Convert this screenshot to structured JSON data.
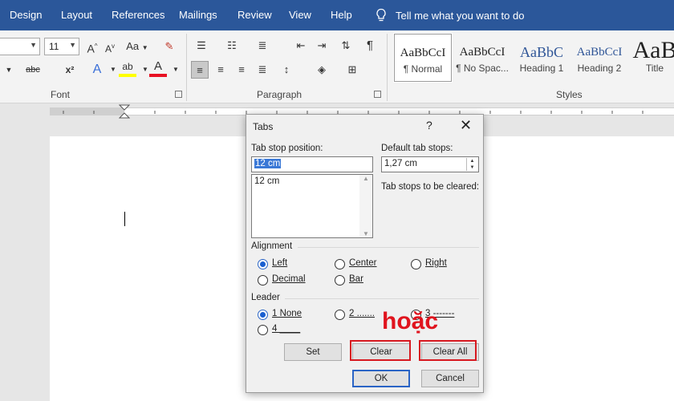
{
  "ribbon_tabs": [
    "Design",
    "Layout",
    "References",
    "Mailings",
    "Review",
    "View",
    "Help"
  ],
  "tell_me": "Tell me what you want to do",
  "font": {
    "size": "11",
    "group_label": "Font",
    "grow_label": "A",
    "shrink_label": "A",
    "case_label": "Aa",
    "strike_label": "abc",
    "superscript_label": "x²",
    "effects_label": "A",
    "highlight_label": "ab",
    "color_label": "A"
  },
  "paragraph": {
    "group_label": "Paragraph",
    "pilcrow": "¶"
  },
  "styles": {
    "group_label": "Styles",
    "items": [
      {
        "sample": "AaBbCcI",
        "name": "¶ Normal"
      },
      {
        "sample": "AaBbCcI",
        "name": "¶ No Spac..."
      },
      {
        "sample": "AaBbC",
        "name": "Heading 1"
      },
      {
        "sample": "AaBbCcI",
        "name": "Heading 2"
      },
      {
        "sample": "AaB",
        "name": "Title"
      }
    ]
  },
  "colors": {
    "ribbon_blue": "#2b579a",
    "highlight_yellow": "#ffff00",
    "font_red": "#e81123",
    "annotation_red": "#d71920"
  },
  "dialog": {
    "title": "Tabs",
    "help": "?",
    "close": "✕",
    "tab_stop_label": "Tab stop position:",
    "tab_stop_value": "12 cm",
    "tab_list": [
      "12 cm"
    ],
    "default_label": "Default tab stops:",
    "default_value": "1,27 cm",
    "cleared_label": "Tab stops to be cleared:",
    "alignment_label": "Alignment",
    "alignment": [
      {
        "label": "Left",
        "selected": true
      },
      {
        "label": "Center",
        "selected": false
      },
      {
        "label": "Right",
        "selected": false
      },
      {
        "label": "Decimal",
        "selected": false
      },
      {
        "label": "Bar",
        "selected": false
      }
    ],
    "leader_label": "Leader",
    "leader": [
      {
        "label": "1 None",
        "selected": true
      },
      {
        "label": "2 .......",
        "selected": false
      },
      {
        "label": "3 -------",
        "selected": false
      },
      {
        "label": "4 ____",
        "selected": false
      }
    ],
    "buttons": {
      "set": "Set",
      "clear": "Clear",
      "clear_all": "Clear All",
      "ok": "OK",
      "cancel": "Cancel"
    }
  },
  "annotation": "hoặc"
}
